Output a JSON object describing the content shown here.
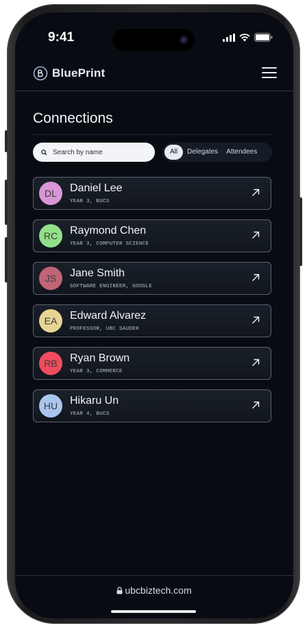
{
  "status_bar": {
    "time": "9:41"
  },
  "app": {
    "name": "BluePrint"
  },
  "page": {
    "title": "Connections"
  },
  "search": {
    "placeholder": "Search by name"
  },
  "filters": [
    {
      "label": "All",
      "active": true
    },
    {
      "label": "Delegates",
      "active": false
    },
    {
      "label": "Attendees",
      "active": false
    }
  ],
  "connections": [
    {
      "initials": "DL",
      "name": "Daniel Lee",
      "meta": "YEAR 3, BUCS",
      "color": "#d996d6"
    },
    {
      "initials": "RC",
      "name": "Raymond Chen",
      "meta": "YEAR 3, COMPUTER SCIENCE",
      "color": "#93df8a"
    },
    {
      "initials": "JS",
      "name": "Jane Smith",
      "meta": "SOFTWARE ENGINEER, GOOGLE",
      "color": "#c06478"
    },
    {
      "initials": "EA",
      "name": "Edward Alvarez",
      "meta": "PROFESSOR, UBC SAUDER",
      "color": "#e6d593"
    },
    {
      "initials": "RB",
      "name": "Ryan Brown",
      "meta": "YEAR 3, COMMERCE",
      "color": "#f04c5e"
    },
    {
      "initials": "HU",
      "name": "Hikaru Un",
      "meta": "YEAR 4, BUCS",
      "color": "#a9c6ef"
    }
  ],
  "footer": {
    "url": "ubcbiztech.com"
  },
  "colors": {
    "background": "#080c12",
    "card_border": "#5a616c",
    "accent": "#9fb6d8"
  }
}
